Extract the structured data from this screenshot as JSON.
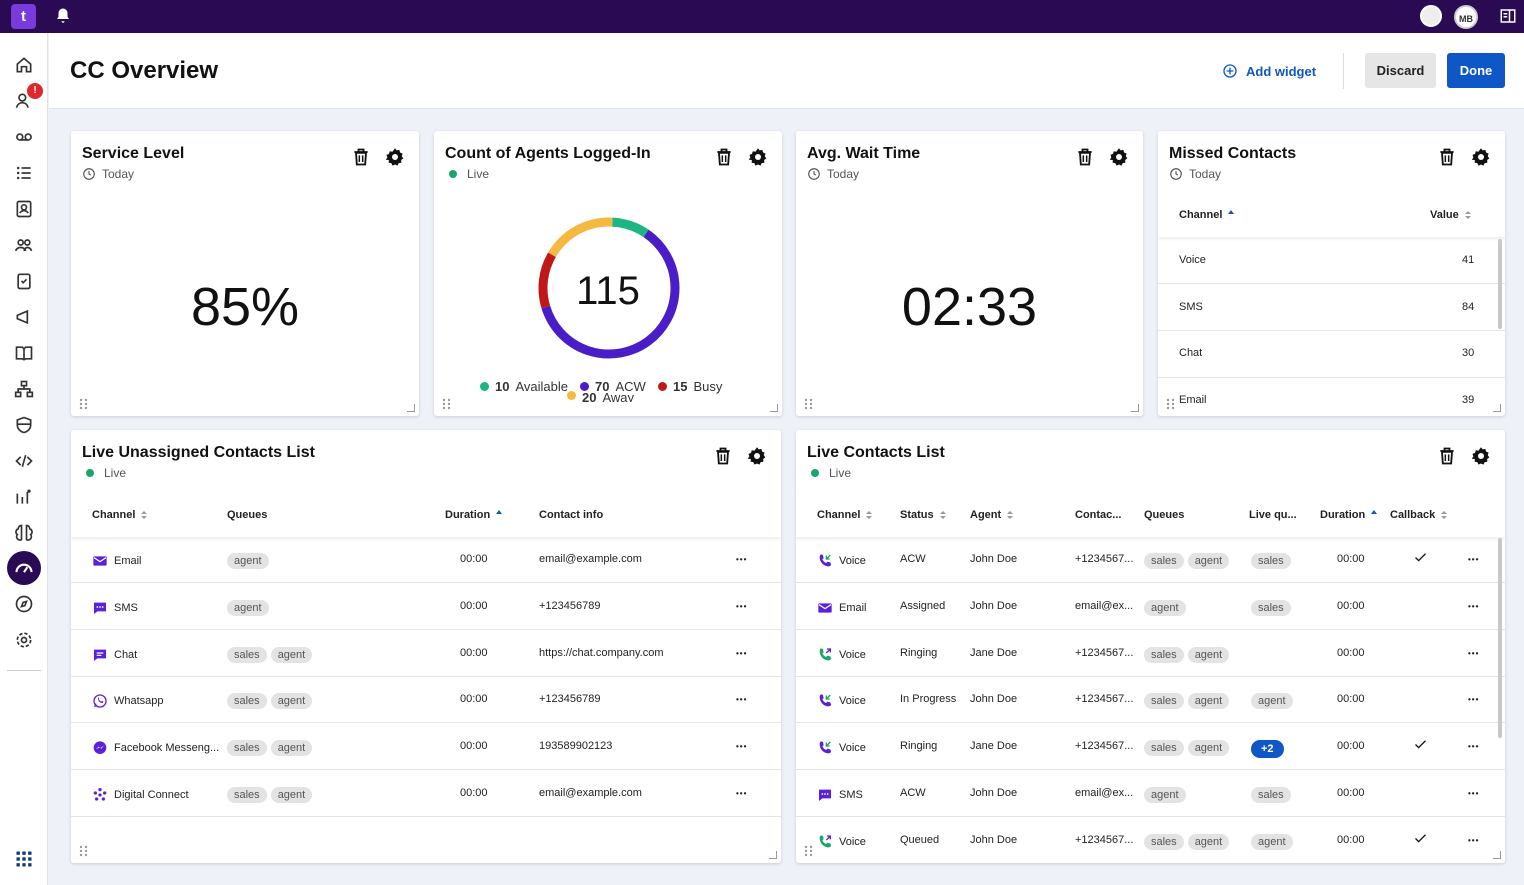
{
  "app": {
    "logo_text": "t",
    "user_initials": "MB",
    "sidebar_badge": "!"
  },
  "header": {
    "title": "CC Overview",
    "add_widget_label": "Add widget",
    "discard_label": "Discard",
    "done_label": "Done"
  },
  "sidebar": {
    "items": [
      "home",
      "agent-activity",
      "voicemail",
      "lists",
      "contacts",
      "teams",
      "tasks",
      "campaigns",
      "knowledge",
      "flows",
      "security",
      "developer",
      "analytics",
      "ai",
      "dashboard",
      "explore",
      "settings",
      "apps"
    ],
    "active": "dashboard"
  },
  "widgets": {
    "service_level": {
      "title": "Service Level",
      "period": "Today",
      "value": "85%"
    },
    "agents_logged_in": {
      "title": "Count of Agents Logged-In",
      "period": "Live",
      "total": "115",
      "legend": [
        {
          "count": "10",
          "label": "Available",
          "color": "#1db584"
        },
        {
          "count": "70",
          "label": "ACW",
          "color": "#4a1ec7"
        },
        {
          "count": "15",
          "label": "Busy",
          "color": "#c01818"
        },
        {
          "count": "20",
          "label": "Away",
          "color": "#f5b942"
        }
      ]
    },
    "avg_wait": {
      "title": "Avg. Wait Time",
      "period": "Today",
      "value": "02:33"
    },
    "missed_contacts": {
      "title": "Missed Contacts",
      "period": "Today",
      "columns": {
        "channel": "Channel",
        "value": "Value"
      },
      "rows": [
        {
          "channel": "Voice",
          "value": "41"
        },
        {
          "channel": "SMS",
          "value": "84"
        },
        {
          "channel": "Chat",
          "value": "30"
        },
        {
          "channel": "Email",
          "value": "39"
        }
      ]
    },
    "unassigned": {
      "title": "Live Unassigned Contacts List",
      "period": "Live",
      "columns": {
        "channel": "Channel",
        "queues": "Queues",
        "duration": "Duration",
        "contact": "Contact info"
      },
      "rows": [
        {
          "icon": "email-icon",
          "channel": "Email",
          "queues": [
            "agent"
          ],
          "duration": "00:00",
          "contact": "email@example.com"
        },
        {
          "icon": "sms-icon",
          "channel": "SMS",
          "queues": [
            "agent"
          ],
          "duration": "00:00",
          "contact": "+123456789"
        },
        {
          "icon": "chat-icon",
          "channel": "Chat",
          "queues": [
            "sales",
            "agent"
          ],
          "duration": "00:00",
          "contact": "https://chat.company.com"
        },
        {
          "icon": "whatsapp-icon",
          "channel": "Whatsapp",
          "queues": [
            "sales",
            "agent"
          ],
          "duration": "00:00",
          "contact": "+123456789"
        },
        {
          "icon": "messenger-icon",
          "channel": "Facebook Messeng...",
          "queues": [
            "sales",
            "agent"
          ],
          "duration": "00:00",
          "contact": "193589902123"
        },
        {
          "icon": "digital-connect-icon",
          "channel": "Digital Connect",
          "queues": [
            "sales",
            "agent"
          ],
          "duration": "00:00",
          "contact": "email@example.com"
        }
      ]
    },
    "live_contacts": {
      "title": "Live Contacts List",
      "period": "Live",
      "columns": {
        "channel": "Channel",
        "status": "Status",
        "agent": "Agent",
        "contact": "Contac...",
        "queues": "Queues",
        "live_queue": "Live qu...",
        "duration": "Duration",
        "callback": "Callback"
      },
      "rows": [
        {
          "icon": "voice-in-icon",
          "channel": "Voice",
          "status": "ACW",
          "agent": "John Doe",
          "contact": "+1234567...",
          "queues": [
            "sales",
            "agent"
          ],
          "live_queue": "sales",
          "duration": "00:00",
          "callback": true
        },
        {
          "icon": "email-icon",
          "channel": "Email",
          "status": "Assigned",
          "agent": "John Doe",
          "contact": "email@ex...",
          "queues": [
            "agent"
          ],
          "live_queue": "sales",
          "duration": "00:00",
          "callback": false
        },
        {
          "icon": "voice-out-icon",
          "channel": "Voice",
          "status": "Ringing",
          "agent": "Jane Doe",
          "contact": "+1234567...",
          "queues": [
            "sales",
            "agent"
          ],
          "live_queue": "",
          "duration": "00:00",
          "callback": false
        },
        {
          "icon": "voice-in-icon",
          "channel": "Voice",
          "status": "In Progress",
          "agent": "John Doe",
          "contact": "+1234567...",
          "queues": [
            "sales",
            "agent"
          ],
          "live_queue": "agent",
          "duration": "00:00",
          "callback": false
        },
        {
          "icon": "voice-in-icon",
          "channel": "Voice",
          "status": "Ringing",
          "agent": "Jane Doe",
          "contact": "+1234567...",
          "queues": [
            "sales",
            "agent"
          ],
          "live_queue": "+2",
          "duration": "00:00",
          "callback": true
        },
        {
          "icon": "sms-icon",
          "channel": "SMS",
          "status": "ACW",
          "agent": "John Doe",
          "contact": "email@ex...",
          "queues": [
            "agent"
          ],
          "live_queue": "sales",
          "duration": "00:00",
          "callback": false
        },
        {
          "icon": "voice-out-icon",
          "channel": "Voice",
          "status": "Queued",
          "agent": "John Doe",
          "contact": "+1234567...",
          "queues": [
            "sales",
            "agent"
          ],
          "live_queue": "agent",
          "duration": "00:00",
          "callback": true
        }
      ]
    }
  },
  "colors": {
    "brand_dark": "#2a0a52",
    "accent": "#0f56c7",
    "live": "#1aa56b",
    "icon_purple": "#5b21d9"
  }
}
